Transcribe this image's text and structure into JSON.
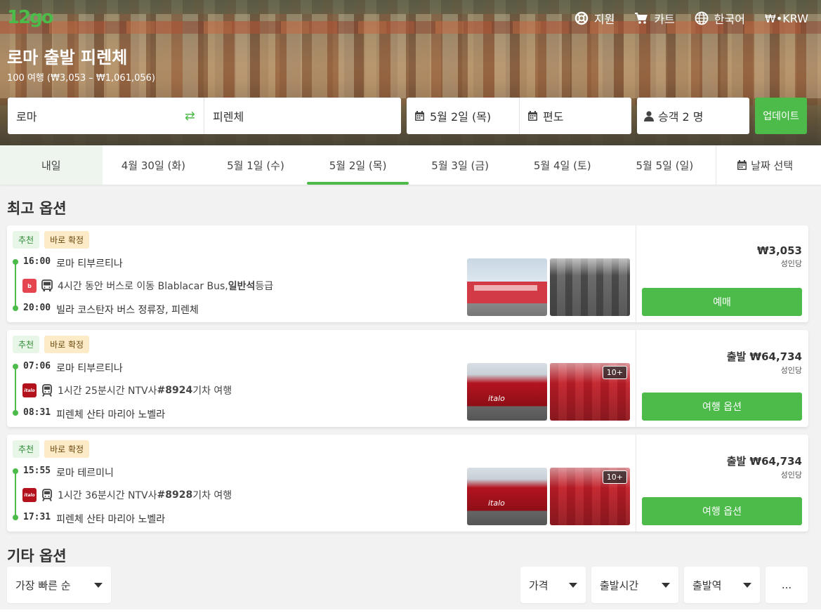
{
  "header": {
    "logo_text": "12go",
    "nav": {
      "support": "지원",
      "cart": "카트",
      "language": "한국어",
      "currency": "₩•KRW"
    },
    "title": "로마 출발 피렌체",
    "subtitle": "100 여행 (₩3,053 – ₩1,061,056)"
  },
  "search": {
    "from": "로마",
    "to": "피렌체",
    "date": "5월 2일 (목)",
    "trip_type": "편도",
    "passengers": "승객 2 명",
    "update_label": "업데이트"
  },
  "date_tabs": [
    {
      "label": "내일"
    },
    {
      "label": "4월 30일 (화)"
    },
    {
      "label": "5월 1일 (수)"
    },
    {
      "label": "5월 2일 (목)",
      "active": true
    },
    {
      "label": "5월 3일 (금)"
    },
    {
      "label": "5월 4일 (토)"
    },
    {
      "label": "5월 5일 (일)"
    }
  ],
  "date_picker_label": "날짜 선택",
  "best_options_title": "최고 옵션",
  "other_options_title": "기타 옵션",
  "trips": [
    {
      "badge_recommended": "추천",
      "badge_instant": "바로 확정",
      "dep_time": "16:00",
      "dep_station": "로마 티부르티나",
      "operator_logo": "bbb",
      "mode": "bus-icon",
      "desc_prefix": "4시간 동안 버스로 이동 Blablacar Bus, ",
      "desc_bold": "일반석",
      "desc_suffix": " 등급",
      "arr_time": "20:00",
      "arr_station": "빌라 코스탄자 버스 정류장, 피렌체",
      "more_photos": "",
      "price": "₩3,053",
      "price_unit": "성인당",
      "button": "예매"
    },
    {
      "badge_recommended": "추천",
      "badge_instant": "바로 확정",
      "dep_time": "07:06",
      "dep_station": "로마 티부르티나",
      "operator_logo": "italo",
      "mode": "train-icon",
      "desc_prefix": "1시간 25분시간 NTV사 ",
      "desc_bold": "#8924",
      "desc_suffix": "기차 여행",
      "arr_time": "08:31",
      "arr_station": "피렌체 산타 마리아 노벨라",
      "more_photos": "10+",
      "price": "출발 ₩64,734",
      "price_unit": "성인당",
      "button": "여행 옵션"
    },
    {
      "badge_recommended": "추천",
      "badge_instant": "바로 확정",
      "dep_time": "15:55",
      "dep_station": "로마 테르미니",
      "operator_logo": "italo",
      "mode": "train-icon",
      "desc_prefix": "1시간 36분시간 NTV사 ",
      "desc_bold": "#8928",
      "desc_suffix": "기차 여행",
      "arr_time": "17:31",
      "arr_station": "피렌체 산타 마리아 노벨라",
      "more_photos": "10+",
      "price": "출발 ₩64,734",
      "price_unit": "성인당",
      "button": "여행 옵션"
    }
  ],
  "filters": {
    "sort": "가장 빠른 순",
    "price": "가격",
    "departure_time": "출발시간",
    "departure_station": "출발역",
    "more": "..."
  },
  "colors": {
    "brand_green": "#4cbb4a",
    "badge_instant_bg": "#fdebc8"
  }
}
